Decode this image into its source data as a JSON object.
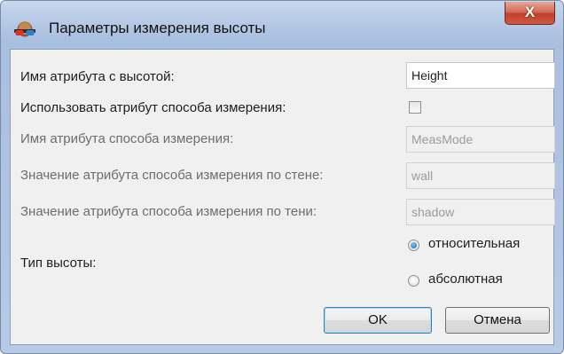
{
  "window": {
    "title": "Параметры измерения высоты",
    "close_glyph": "X",
    "icon": "stereo-glasses-icon"
  },
  "form": {
    "height_attr_label": "Имя атрибута с высотой:",
    "height_attr_value": "Height",
    "use_mode_attr_label": "Использовать атрибут способа измерения:",
    "use_mode_attr_checked": false,
    "mode_attr_label": "Имя атрибута способа измерения:",
    "mode_attr_value": "MeasMode",
    "wall_value_label": "Значение атрибута способа измерения по стене:",
    "wall_value": "wall",
    "shadow_value_label": "Значение атрибута способа измерения по тени:",
    "shadow_value": "shadow",
    "height_type_label": "Тип высоты:",
    "height_type_options": [
      "относительная",
      "абсолютная"
    ],
    "height_type_selected": "относительная"
  },
  "buttons": {
    "ok": "OK",
    "cancel": "Отмена"
  },
  "colors": {
    "frame": "#b9cbe6",
    "close_button": "#c2402a",
    "client_bg": "#f0f0f0"
  }
}
